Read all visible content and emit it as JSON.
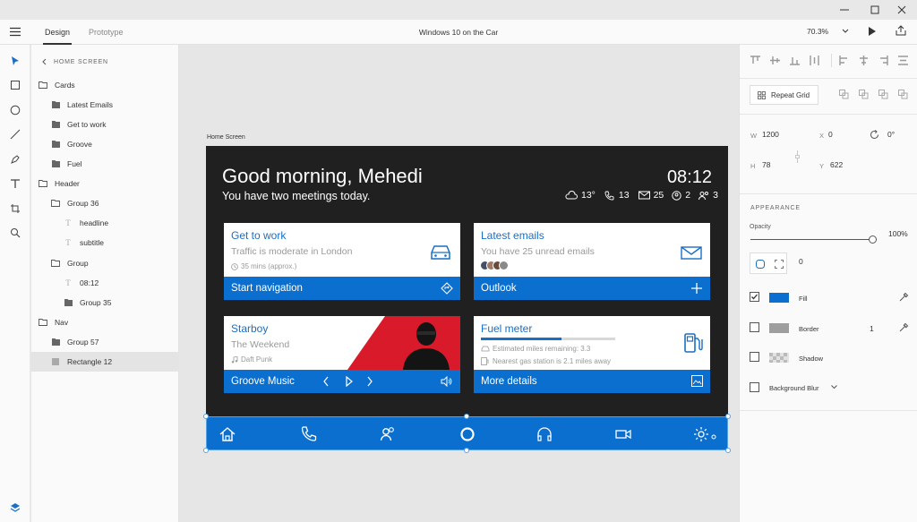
{
  "window": {
    "controls": [
      "minimize",
      "maximize",
      "close"
    ]
  },
  "topbar": {
    "tabs": [
      {
        "label": "Design"
      },
      {
        "label": "Prototype"
      }
    ],
    "doc_title": "Windows 10 on the Car",
    "zoom": "70.3%"
  },
  "layers": {
    "header": "HOME SCREEN",
    "items": [
      {
        "label": "Cards"
      },
      {
        "label": "Latest Emails"
      },
      {
        "label": "Get to work"
      },
      {
        "label": "Groove"
      },
      {
        "label": "Fuel"
      },
      {
        "label": "Header"
      },
      {
        "label": "Group 36"
      },
      {
        "label": "headline"
      },
      {
        "label": "subtitle"
      },
      {
        "label": "Group"
      },
      {
        "label": "08:12"
      },
      {
        "label": "Group 35"
      },
      {
        "label": "Nav"
      },
      {
        "label": "Group 57"
      },
      {
        "label": "Rectangle 12"
      }
    ]
  },
  "artboard": {
    "label": "Home Screen",
    "greeting": "Good morning, Mehedi",
    "subtitle": "You have two meetings today.",
    "clock": "08:12",
    "status": {
      "weather": "13°",
      "calls": "13",
      "mail": "25",
      "contacts": "2",
      "people": "3"
    },
    "cards": {
      "work": {
        "title": "Get to work",
        "sub": "Traffic is moderate in London",
        "small": "35 mins (approx.)",
        "action": "Start navigation"
      },
      "email": {
        "title": "Latest emails",
        "sub": "You have 25 unread emails",
        "action": "Outlook"
      },
      "music": {
        "title": "Starboy",
        "sub": "The Weekend",
        "small": "Daft Punk",
        "action": "Groove Music"
      },
      "fuel": {
        "title": "Fuel meter",
        "line1": "Estimated miles remaining: 3.3",
        "line2": "Nearest gas station is 2.1 miles away",
        "action": "More details",
        "level": 0.6
      }
    }
  },
  "props": {
    "repeat_grid": "Repeat Grid",
    "w_label": "W",
    "w": "1200",
    "x_label": "X",
    "x": "0",
    "h_label": "H",
    "h": "78",
    "y_label": "Y",
    "y": "622",
    "rotation": "0°",
    "appearance": "APPEARANCE",
    "opacity_label": "Opacity",
    "opacity": "100%",
    "radius": "0",
    "fill_label": "Fill",
    "fill_color": "#0a6fcf",
    "border_label": "Border",
    "border_color": "#9e9e9e",
    "border_width": "1",
    "shadow_label": "Shadow",
    "blur_label": "Background Blur"
  },
  "colors": {
    "accent": "#0a6fcf",
    "artboard_bg": "#202020"
  }
}
